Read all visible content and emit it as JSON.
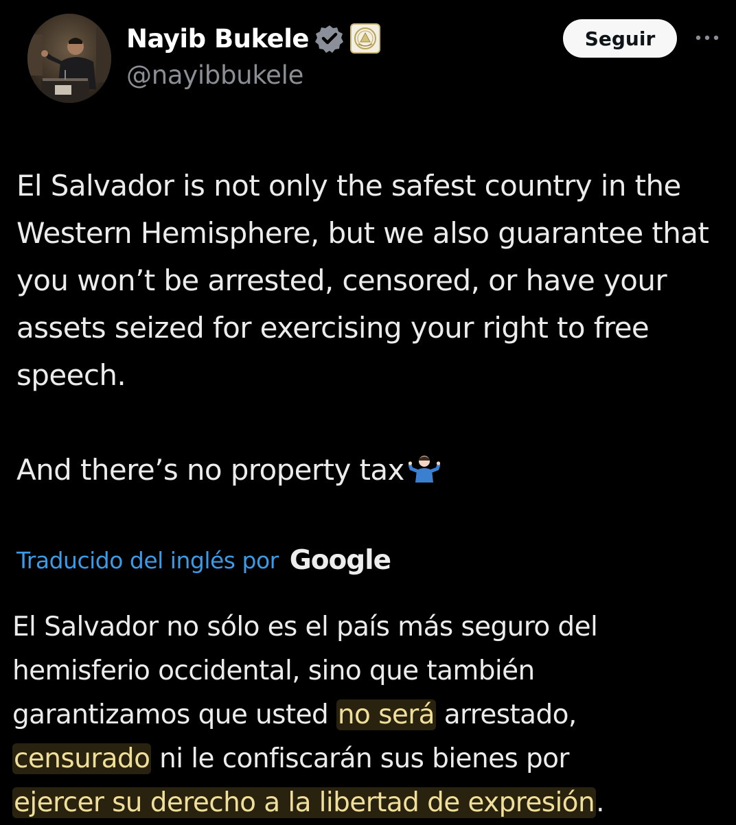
{
  "author": {
    "display_name": "Nayib Bukele",
    "handle": "@nayibbukele",
    "verified_badge": "verified-icon",
    "affiliation_badge": "el-salvador-seal-icon"
  },
  "actions": {
    "follow_label": "Seguir",
    "more_icon": "more-icon"
  },
  "tweet": {
    "paragraph_1": "El Salvador is not only the safest country in the Western Hemisphere, but we also guarantee that you won’t be arrested, censored, or have your assets seized for exercising your right to free speech.",
    "paragraph_2": "And there’s no property tax",
    "paragraph_2_emoji": "person-shrugging-emoji"
  },
  "translation": {
    "label": "Traducido del inglés por",
    "provider": "Google",
    "line_1": "El Salvador no sólo es el país más seguro del",
    "line_2": "hemisferio occidental, sino que también",
    "line_3_before": "garantizamos que usted ",
    "line_3_highlight": "no será",
    "line_3_after": " arrestado,",
    "line_4_highlight": "censurado",
    "line_4_after": " ni le confiscarán sus bienes por",
    "line_5_highlight": "ejercer su derecho a la libertad de expresión",
    "line_5_after": ".",
    "highlight_color": "#f0df9a"
  },
  "colors": {
    "background": "#000000",
    "text": "#ececec",
    "secondary": "#8b8f95",
    "link": "#3b9be6",
    "verified": "#8a8f99"
  }
}
